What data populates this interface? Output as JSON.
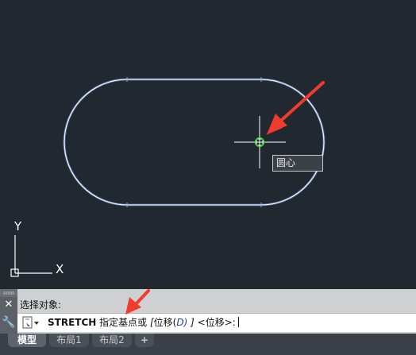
{
  "viewport": {
    "tooltip_text": "圆心",
    "ucs_x_label": "X",
    "ucs_y_label": "Y",
    "colors": {
      "background": "#212830",
      "slot_outline": "#dfe6f2",
      "crosshair": "#ffffff",
      "osnap_marker": "#2fd62f",
      "annotation_arrow": "#f03c2e"
    }
  },
  "command_line": {
    "history_text": "选择对象:",
    "prompt": {
      "command": "STRETCH",
      "instruction": "指定基点或",
      "bracket_open": "[",
      "option_name": "位移(",
      "option_key": "D",
      "option_close": ")",
      "bracket_close": "]",
      "default_value": "<位移>:"
    },
    "close_icon": "close-icon",
    "customize_icon": "wrench-icon"
  },
  "layout_tabs": {
    "items": [
      {
        "label": "模型",
        "active": true
      },
      {
        "label": "布局1",
        "active": false
      },
      {
        "label": "布局2",
        "active": false
      }
    ],
    "add_label": "+"
  }
}
